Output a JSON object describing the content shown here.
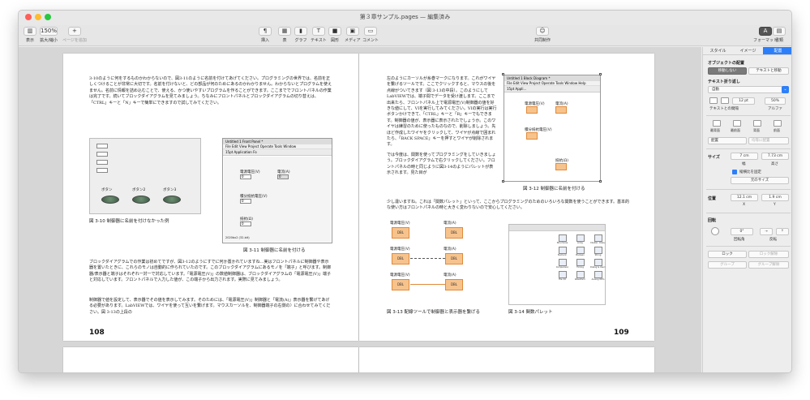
{
  "window": {
    "title": "第３章サンプル.pages — 編集済み",
    "traffic": [
      "#ff5f57",
      "#febc2e",
      "#28c840"
    ]
  },
  "toolbar": {
    "view_label": "表示",
    "zoom_value": "150%",
    "zoom_label": "拡大/縮小",
    "add_page_label": "ページを追加",
    "insert_label": "挿入",
    "table_label": "表",
    "graph_label": "グラフ",
    "text_label": "テキスト",
    "shape_label": "図形",
    "media_label": "メディア",
    "comment_label": "コメント",
    "collab_label": "共同制作",
    "format_label": "フォーマット",
    "document_label": "書類"
  },
  "left_page": {
    "para1": "3-10のように何をするものかわからないので、図3-11のように名前を付けてあげてください。プログラミングの世界では、名前を正しくつけることが非常に大切です。名前を付けないと、どの部品が何のためにあるのかわかりません。わからないとプログラムを使えません。名前に情報を詰め込むことで、使える、かつ使いやすいプログラムを作ることができます。ここまででフロントパネルの作業は完了です。続いてブロックダイアグラムを見てみましょう。ちなみにフロントパネルとブロックダイアグラムの切り替えは、「CTRL」キーと「N」キーで簡単にできますので試してみてください。",
    "fig10_caption": "図 3-10 制御器に名前を付けなかった例",
    "fig10_button_labels": [
      "ボタン",
      "ボタン2",
      "ボタン3"
    ],
    "fig11_title": "Untitled 1 Front Panel *",
    "fig11_menu": "File  Edit  View  Project  Operate  Tools  Window",
    "fig11_font": "15pt Application Fo",
    "fig11_labels": [
      "電源電圧(V)",
      "電流(A)",
      "積分抵抗電圧(V)",
      "抵抗(Ω)"
    ],
    "fig11_value": "0",
    "fig11_footer": "2020bx2 (32-bit)",
    "fig11_caption": "図 3-11 制御器に名前を付ける",
    "para2": "ブロックダイアグラムでの作業は初めてですが、図3-12のようにすでに何か置かれていますね…実はフロントパネルに制御器や表示器を置いたときに、これらのモノは自動的に作られていたのです。このブロックダイアグラムにあるモノを「端子」と呼びます。制御器/表示器と端子はそれぞれ一対一で対応しています。「電源電圧(V)」の数値制御器は、ブロックダイアグラムの「電源電圧(V)」端子と対応しています。フロントパネルで入力した値が、この端子から出力されます。実際に見てみましょう。",
    "para3": "制御器で値を設定して、表示器でその値を表示してみます。そのためには、「電源電圧(V)」制御器と「電流(A)」表示器を繋げてあげる必要があります。LabVIEWでは、ワイヤを使って互いを繋げます。マウスカーソルを、制御器端子の右側の〉に合わせてみてください。図 3-13の上段の",
    "page_number": "108"
  },
  "right_page": {
    "para1": "左のようにカーソルが糸巻マークになります。これがワイヤを繋げるツールです。ここでクリックすると、マウスの後を点線がついてきます（図 3-13の中段）。このようにしてLabVIEWでは、端子間でデータを受け渡します。ここまで出来たら、フロントパネル上で電源電圧(V)制御器の値を好きな値にして、VIを実行してみてください。VIの実行は実行ボタンかけできて、「CTRL」キーと「R」キーでもできます。制御器の値が、表示器に表示されたでしょうか。このワイヤは練習のために使ったものなので、削除しましょう。先ほど作成したワイヤをクリックして、ワイヤが点線で囲まれたら、「BACK SPACE」キーを押すとワイヤが削除されます。",
    "para2": "では今度は、関数を使ってプログラミングをしていきましょう。ブロックダイアグラムで右クリックしてください。フロントパネルの時と同じように図3-14のようにパレットが表示されます。見た目が",
    "para3": "少し違いますね。これは「関数パレット」といって、ここからプログラミングのためのいろいろな関数を使うことができます。基本的な使い方はフロントパネルの時と大きく変わりないので安心してください。",
    "fig12_title": "Untitled 1 Block Diagram *",
    "fig12_menu": "File  Edit  View  Project  Operate  Tools  Window  Help",
    "fig12_font": "15pt Appli...",
    "fig12_labels": [
      "電源電圧(V)",
      "電流(A)",
      "積分抵抗電圧(V)",
      "抵抗(Ω)"
    ],
    "fig12_caption": "図 3-12 制御器に名前を付ける",
    "fig13_labels": [
      "電源電圧(V)",
      "電流(A)"
    ],
    "fig13_term": "DBL",
    "fig13_caption": "図 3-13 配線ツールで制御器と表示器を繋げる",
    "fig14_caption": "図 3-14 関数パレット",
    "fig14_items": [
      "Structures",
      "Array",
      "Cluster, Class, & Variant",
      "Numeric",
      "Boolean",
      "String",
      "Comparison",
      "Timing",
      "Dialog & User Interface",
      "File I/O",
      "Waveform",
      "Analog Wfm"
    ],
    "page_number": "109"
  },
  "sidebar": {
    "tabs": [
      "スタイル",
      "イメージ",
      "配置"
    ],
    "object_placement": "オブジェクトの配置",
    "stay_on_page": "移動しない",
    "move_with_text": "テキストと移動",
    "text_wrap": "テキスト折り返し",
    "wrap_value": "自動",
    "wrap_label": "テキストとの間隔",
    "spacing_value": "12 pt",
    "alpha_value": "50%",
    "alpha_label": "アルファ",
    "arrange_labels": [
      "最背面",
      "最前面",
      "背面",
      "前面"
    ],
    "align_value": "配置",
    "distribute_value": "均等に配置",
    "size_label": "サイズ",
    "width_value": "7 cm",
    "height_value": "7.73 cm",
    "width_label": "幅",
    "height_label": "高さ",
    "constrain_label": "縦横比を固定",
    "original_size": "元のサイズ",
    "position_label": "位置",
    "x_value": "12.1 cm",
    "y_value": "1.9 cm",
    "x_label": "X",
    "y_label": "Y",
    "rotate_label": "回転",
    "angle_value": "0°",
    "angle_label": "回転角",
    "flip_label": "反転",
    "lock_label": "ロック",
    "unlock_label": "ロック解除",
    "group_label": "グループ",
    "ungroup_label": "グループ解除"
  }
}
